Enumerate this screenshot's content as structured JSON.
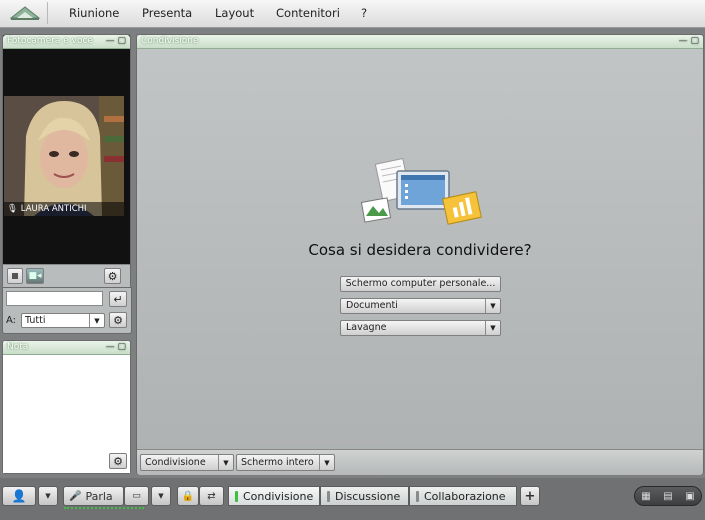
{
  "menubar": {
    "items": [
      "Riunione",
      "Presenta",
      "Layout",
      "Contenitori",
      "?"
    ]
  },
  "camera_panel": {
    "title": "Fotocamera e voce",
    "participant_name": "LAURA ANTICHI"
  },
  "chat_panel": {
    "to_label": "A:",
    "recipient": "Tutti",
    "message_value": ""
  },
  "notes_panel": {
    "title": "Nota"
  },
  "share_panel": {
    "title": "Condivisione",
    "question": "Cosa si desidera condividere?",
    "btn_screen": "Schermo computer personale...",
    "btn_documents": "Documenti",
    "btn_whiteboards": "Lavagne",
    "footer_share": "Condivisione",
    "footer_fullscreen": "Schermo intero"
  },
  "bottombar": {
    "talk_label": "Parla",
    "tabs": [
      "Condivisione",
      "Discussione",
      "Collaborazione"
    ],
    "add_label": "+"
  },
  "colors": {
    "active_tab_indicator": "#3fbf3f",
    "inactive_tab_indicator": "#8a8a8a",
    "panel_header": "#c9ddc9"
  }
}
